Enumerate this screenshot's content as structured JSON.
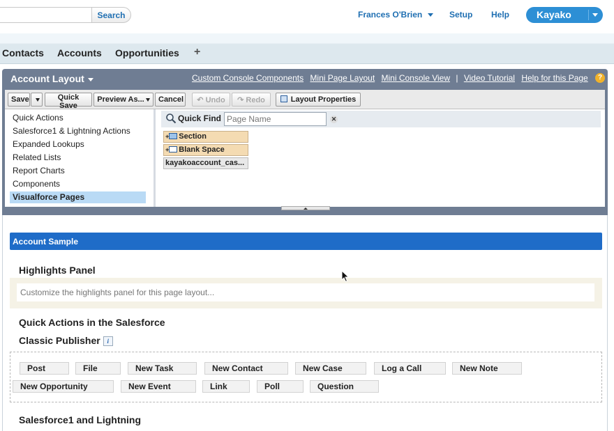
{
  "header": {
    "search_placeholder": "",
    "search_button": "Search",
    "user_name": "Frances O'Brien",
    "setup": "Setup",
    "help": "Help",
    "app_name": "Kayako"
  },
  "tabs": [
    "Contacts",
    "Accounts",
    "Opportunities"
  ],
  "tab_add": "+",
  "editor": {
    "title": "Account Layout",
    "links": [
      "Custom Console Components",
      "Mini Page Layout",
      "Mini Console View",
      "Video Tutorial",
      "Help for this Page"
    ],
    "help_icon": "?",
    "toolbar": {
      "save": "Save",
      "quick_save": "Quick Save",
      "preview_as": "Preview As...",
      "cancel": "Cancel",
      "undo": "Undo",
      "redo": "Redo",
      "layout_properties": "Layout Properties"
    },
    "categories": [
      "Quick Actions",
      "Salesforce1 & Lightning Actions",
      "Expanded Lookups",
      "Related Lists",
      "Report Charts",
      "Components",
      "Visualforce Pages"
    ],
    "selected_category": "Visualforce Pages",
    "quick_find_label": "Quick Find",
    "quick_find_placeholder": "Page Name",
    "palette_items": [
      "Section",
      "Blank Space",
      "kayakoaccount_cas..."
    ]
  },
  "layout": {
    "section_title": "Account Sample",
    "highlights_heading": "Highlights Panel",
    "highlights_placeholder": "Customize the highlights panel for this page layout...",
    "quick_actions_heading_line1": "Quick Actions in the Salesforce",
    "quick_actions_heading_line2": "Classic Publisher",
    "info_icon": "i",
    "actions_row1": [
      "Post",
      "File",
      "New Task",
      "New Contact",
      "New Case",
      "Log a Call",
      "New Note"
    ],
    "actions_row2": [
      "New Opportunity",
      "New Event",
      "Link",
      "Poll",
      "Question"
    ],
    "sf1_heading": "Salesforce1 and Lightning"
  },
  "colors": {
    "link_blue": "#1f6fb2",
    "app_button": "#2d8fd5",
    "editor_frame": "#6f7d93",
    "section_bar": "#1f6cc8",
    "selected_category": "#b9daf5"
  }
}
